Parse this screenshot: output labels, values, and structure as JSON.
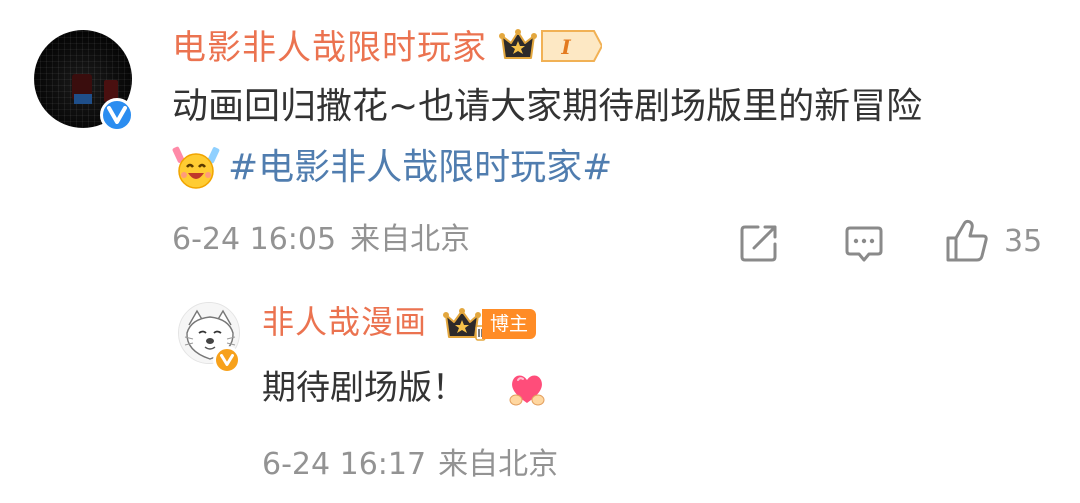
{
  "comment": {
    "author": "电影非人哉限时玩家",
    "badge_level": "I",
    "text": "动画回归撒花~也请大家期待剧场版里的新冒险",
    "hashtag": "#电影非人哉限时玩家#",
    "date": "6-24 16:05",
    "location": "来自北京",
    "like_count": "35",
    "avatar_verified": "blue-v-verified-icon"
  },
  "reply": {
    "author": "非人哉漫画",
    "host_tag": "博主",
    "text": "期待剧场版！",
    "date": "6-24 16:17",
    "location": "来自北京",
    "avatar_verified": "orange-v-verified-icon"
  },
  "colors": {
    "name": "#eb7350",
    "hashtag": "#507daf",
    "meta": "#939393",
    "text": "#333333",
    "host_tag_bg": "#ff8c26",
    "verify_blue": "#2b8df0",
    "verify_orange": "#f7a11b"
  }
}
